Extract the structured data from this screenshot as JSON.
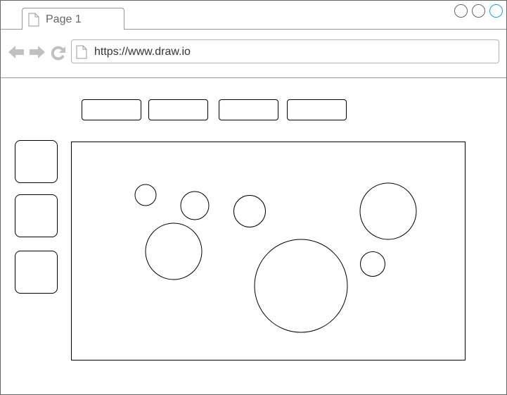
{
  "browser": {
    "tab": {
      "label": "Page 1",
      "icon": "page-icon"
    },
    "window_controls": [
      {
        "name": "window-control-circle",
        "icon": "circle-icon"
      },
      {
        "name": "window-control-circle",
        "icon": "circle-icon"
      },
      {
        "name": "window-control-circle-active",
        "icon": "circle-icon",
        "accent": "#0ea7d6"
      }
    ],
    "nav": {
      "back_icon": "arrow-left-icon",
      "forward_icon": "arrow-right-icon",
      "reload_icon": "reload-icon"
    },
    "url": "https://www.draw.io"
  },
  "content": {
    "top_buttons": [
      {
        "label": ""
      },
      {
        "label": ""
      },
      {
        "label": ""
      },
      {
        "label": ""
      }
    ],
    "side_buttons": [
      {
        "label": ""
      },
      {
        "label": ""
      },
      {
        "label": ""
      }
    ],
    "canvas": {
      "shapes": [
        {
          "type": "circle"
        },
        {
          "type": "circle"
        },
        {
          "type": "circle"
        },
        {
          "type": "circle"
        },
        {
          "type": "circle"
        },
        {
          "type": "circle"
        },
        {
          "type": "circle"
        }
      ]
    }
  },
  "colors": {
    "frame": "#666666",
    "divider": "#999999",
    "icon_gray": "#c0c0c0",
    "accent": "#0ea7d6"
  }
}
